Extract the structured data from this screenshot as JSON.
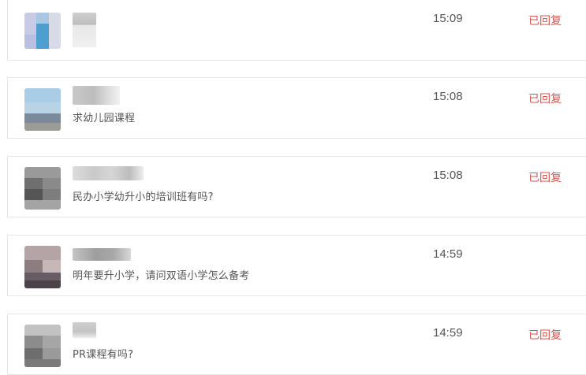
{
  "messages": [
    {
      "name": "",
      "text": "",
      "time": "15:09",
      "status": "已回复"
    },
    {
      "name": "",
      "text": "求幼儿园课程",
      "time": "15:08",
      "status": "已回复"
    },
    {
      "name": "",
      "text": "民办小学幼升小的培训班有吗?",
      "time": "15:08",
      "status": "已回复"
    },
    {
      "name": "",
      "text": "明年要升小学，请问双语小学怎么备考",
      "time": "14:59",
      "status": ""
    },
    {
      "name": "",
      "text": "PR课程有吗?",
      "time": "14:59",
      "status": "已回复"
    }
  ],
  "colors": {
    "status_red": "#d9534f",
    "text_gray": "#555555",
    "border": "#e6e6e6"
  }
}
